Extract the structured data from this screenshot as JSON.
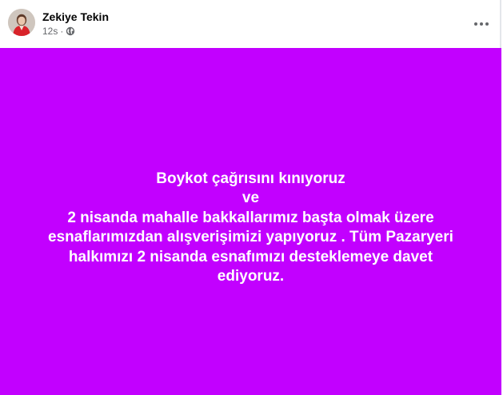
{
  "post": {
    "author": "Zekiye Tekin",
    "timestamp": "12s",
    "separator": "·",
    "privacy_icon": "globe-icon",
    "menu_icon": "more-horizontal-icon",
    "background_color": "#c200ff",
    "text_color": "#ffffff",
    "lines": [
      "Boykot çağrısını kınıyoruz",
      "ve",
      "2 nisanda mahalle bakkallarımız başta olmak üzere",
      "esnaflarımızdan alışverişimizi yapıyoruz . Tüm Pazaryeri",
      "halkımızı 2 nisanda esnafımızı desteklemeye davet",
      "ediyoruz."
    ]
  }
}
